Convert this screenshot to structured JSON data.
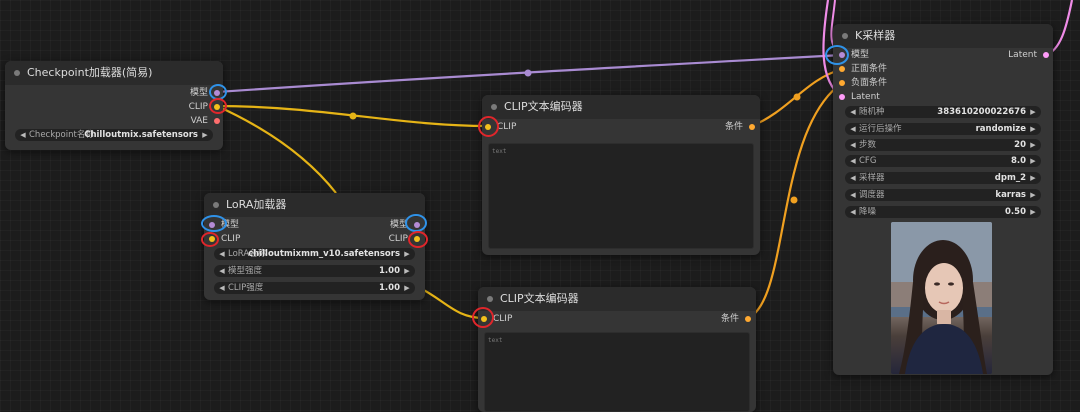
{
  "colors": {
    "model": "#b48bd6",
    "clip": "#f2c01c",
    "vae": "#ff6e6e",
    "conditioning": "#ffa931",
    "latent": "#ff9cf9",
    "wire_model": "#a98bd2",
    "wire_clip": "#e6b416",
    "wire_cond": "#f0a020",
    "wire_latent": "#f08ce8",
    "ring_red": "#e0262b",
    "ring_blue": "#2f92e8"
  },
  "checkpoint": {
    "title": "Checkpoint加载器(简易)",
    "outputs": [
      "模型",
      "CLIP",
      "VAE"
    ],
    "widget": {
      "label": "Checkpoint名称",
      "value": "Chilloutmix.safetensors"
    }
  },
  "lora": {
    "title": "LoRA加载器",
    "inputs": [
      "模型",
      "CLIP"
    ],
    "outputs": [
      "模型",
      "CLIP"
    ],
    "widgets": [
      {
        "label": "LoRA名称",
        "value": "chilloutmixmm_v10.safetensors"
      },
      {
        "label": "模型强度",
        "value": "1.00"
      },
      {
        "label": "CLIP强度",
        "value": "1.00"
      }
    ]
  },
  "clip_top": {
    "title": "CLIP文本编码器",
    "input": "CLIP",
    "output": "条件",
    "text": "text"
  },
  "clip_bottom": {
    "title": "CLIP文本编码器",
    "input": "CLIP",
    "output": "条件",
    "text": "text"
  },
  "ksampler": {
    "title": "K采样器",
    "inputs": [
      "模型",
      "正面条件",
      "负面条件",
      "Latent"
    ],
    "output": "Latent",
    "widgets": [
      {
        "label": "随机种",
        "value": "383610200022676"
      },
      {
        "label": "运行后操作",
        "value": "randomize"
      },
      {
        "label": "步数",
        "value": "20"
      },
      {
        "label": "CFG",
        "value": "8.0"
      },
      {
        "label": "采样器",
        "value": "dpm_2"
      },
      {
        "label": "调度器",
        "value": "karras"
      },
      {
        "label": "降噪",
        "value": "0.50"
      }
    ]
  }
}
